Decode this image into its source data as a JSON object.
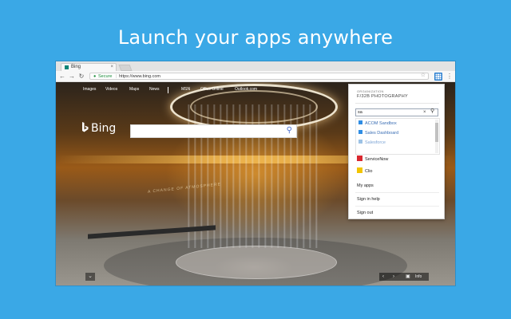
{
  "headline": "Launch your apps anywhere",
  "browser": {
    "tab_title": "Bing",
    "tab_close": "×",
    "nav": {
      "back": "←",
      "forward": "→",
      "reload": "↻"
    },
    "address": {
      "secure_label": "Secure",
      "url": "https://www.bing.com",
      "star": "☆"
    },
    "ext_icon": "apps-grid-icon",
    "menu_icon": "⋮"
  },
  "bing": {
    "nav_items": [
      "Images",
      "Videos",
      "Maps",
      "News",
      "MSN",
      "Office Online",
      "Outlook.com"
    ],
    "logo_text": "Bing",
    "overlay_text": "A CHANGE OF ATMOSPHERE",
    "bottom": {
      "collapse": "⌄",
      "prev": "‹",
      "next": "›",
      "info": "Info"
    }
  },
  "panel": {
    "org_label": "ORGANIZATION",
    "org_name": "F/32B PHOTOGRAPHY",
    "search_value": "sa",
    "clear": "×",
    "results": [
      {
        "label": "ACOM Sandbox",
        "color": "#2f8de4"
      },
      {
        "label": "Sales Dashboard",
        "color": "#2f8de4"
      },
      {
        "label": "Salesforce",
        "color": "#9cc2e5"
      }
    ],
    "apps": [
      {
        "label": "ServiceNow",
        "color": "#d9282f"
      },
      {
        "label": "Clio",
        "color": "#f2c400"
      }
    ],
    "links": [
      "My apps",
      "Sign in help",
      "Sign out"
    ]
  },
  "colors": {
    "background": "#3aa8e6",
    "accent": "#2b7fd0"
  }
}
